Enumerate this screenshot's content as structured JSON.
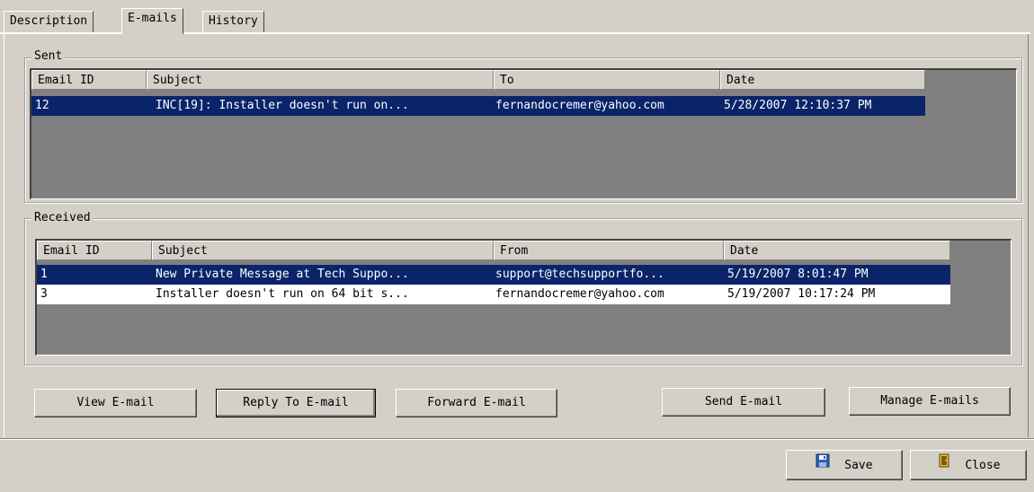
{
  "tabs": [
    "Description",
    "E-mails",
    "History"
  ],
  "sent": {
    "legend": "Sent",
    "headers": [
      "Email ID",
      "Subject",
      "To",
      "Date"
    ],
    "rows": [
      [
        "12",
        "INC[19]: Installer doesn't run on...",
        "fernandocremer@yahoo.com",
        "5/28/2007 12:10:37 PM"
      ]
    ]
  },
  "received": {
    "legend": "Received",
    "headers": [
      "Email ID",
      "Subject",
      "From",
      "Date"
    ],
    "rows": [
      [
        "1",
        "New Private Message at Tech Suppo...",
        "support@techsupportfo...",
        "5/19/2007 8:01:47 PM"
      ],
      [
        "3",
        "Installer doesn't run on 64 bit s...",
        "fernandocremer@yahoo.com",
        "5/19/2007 10:17:24 PM"
      ]
    ]
  },
  "actions": {
    "view": "View E-mail",
    "reply": "Reply To E-mail",
    "forward": "Forward E-mail",
    "send": "Send E-mail",
    "manage": "Manage E-mails"
  },
  "footer": {
    "save": "Save",
    "close": "Close"
  },
  "icons": {
    "save": "floppy-disk-icon",
    "close": "exit-door-icon"
  },
  "colors": {
    "selection": "#0a246a",
    "window": "#d4d0c8",
    "grid_background": "#808080"
  }
}
